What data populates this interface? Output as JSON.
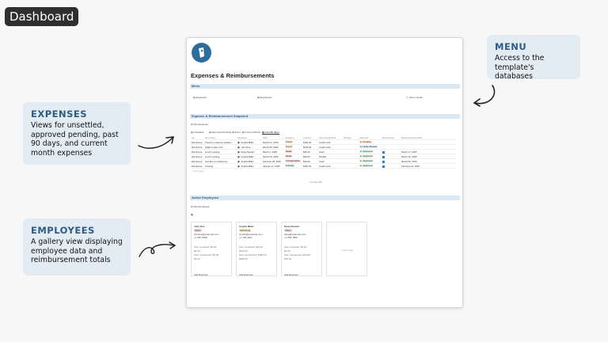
{
  "badge": "Dashboard",
  "callouts": {
    "expenses": {
      "title": "EXPENSES",
      "body": "Views for unsettled, approved pending, past 90 days, and current month expenses"
    },
    "employees": {
      "title": "EMPLOYEES",
      "body": "A gallery view displaying employee data and reimbursement totals"
    },
    "menu": {
      "title": "MENU",
      "body": "Access to the template's databases"
    }
  },
  "colors": {
    "accent": "#2d5b83",
    "callout_bg": "#e4ecf3",
    "section_bar": "#dbe8f3"
  },
  "page": {
    "title": "Expenses & Reimbursements",
    "menu": {
      "header": "Menu",
      "links": [
        {
          "label": "Expenses",
          "icon": "receipt-icon"
        },
        {
          "label": "Employees",
          "icon": "people-icon"
        },
        {
          "label": "How it works",
          "icon": "info-icon"
        }
      ]
    },
    "snapshot": {
      "header": "Expense & Reimbursement Snapshot",
      "new_button": "New Expense",
      "views": [
        "Unsettled",
        "Approved Pending Reimbu...",
        "Current Month",
        "Last 90 days"
      ],
      "columns": [
        "Aa",
        "Item Name",
        "Employee",
        "Date",
        "Category",
        "Amount",
        "Payment Method",
        "Receipt",
        "Approval",
        "Reimbursed",
        "Reimbursement Date"
      ],
      "rows": [
        {
          "type": "Reimburse",
          "item": "Travel to customer location",
          "employee": "Sophia Miller",
          "date": "March 01, 2025",
          "category": "Travel",
          "amount": "$100.00",
          "method": "Credit Card",
          "approval": "Pending",
          "reimbursed": false,
          "reimb_date": ""
        },
        {
          "type": "Reimburse",
          "item": "Flight to New York",
          "employee": "John Doe",
          "date": "March 08, 2025",
          "category": "Travel",
          "amount": "$135.00",
          "method": "Credit Card",
          "approval": "Under Review",
          "reimbursed": false,
          "reimb_date": ""
        },
        {
          "type": "Reimburse",
          "item": "Lunch meeting",
          "employee": "Dana Stewart",
          "date": "March 4, 2025",
          "category": "Meals",
          "amount": "$35.00",
          "method": "Cash",
          "approval": "Approved",
          "reimbursed": true,
          "reimb_date": "March 17, 2025"
        },
        {
          "type": "Reimburse",
          "item": "Lunch meeting",
          "employee": "Sophia Miller",
          "date": "March 03, 2025",
          "category": "Meals",
          "amount": "$45.00",
          "method": "PayPal",
          "approval": "Approved",
          "reimbursed": true,
          "reimb_date": "March 15, 2025"
        },
        {
          "type": "Reimburse",
          "item": "Taxi fare to conference",
          "employee": "Sophia Miller",
          "date": "February 28, 2025",
          "category": "Transportation",
          "amount": "$40.00",
          "method": "Cash",
          "approval": "Approved",
          "reimbursed": true,
          "reimb_date": "March 06, 2025"
        },
        {
          "type": "Reimburse",
          "item": "Training",
          "employee": "Sophia Miller",
          "date": "January 27, 2025",
          "category": "Training",
          "amount": "$300.00",
          "method": "Credit Card",
          "approval": "Approved",
          "reimbursed": true,
          "reimb_date": "February 10, 2025"
        }
      ],
      "new_row": "+ New page",
      "sum_label": "sum $1,185"
    },
    "employees": {
      "header": "Active Employees",
      "new_button": "New Employee",
      "cards": [
        {
          "name": "John Doe",
          "dept": "Sales",
          "dept_color": "#f7d7d7",
          "email": "johndoe@example.com",
          "phone": "+1 987 6548",
          "lines": [
            "Sum unsettled: $0.00",
            "$0.00",
            "Sum reimbursed: $0.00",
            "$0.00"
          ],
          "add": "Add Expense"
        },
        {
          "name": "Sophia Miller",
          "dept": "Marketing",
          "dept_color": "#fbe3c8",
          "email": "sophia@example.com",
          "phone": "+1 765 4321",
          "lines": [
            "Sum unsettled: $40.00",
            "$100.00",
            "Sum reimbursed: $385.00",
            "$385.00"
          ],
          "add": "Add Expense"
        },
        {
          "name": "Dana Stewart",
          "dept": "Sales",
          "dept_color": "#f7d7d7",
          "email": "dana@example.com",
          "phone": "+1 555 7890",
          "lines": [
            "Sum unsettled: $0.00",
            "$0.00",
            "Sum reimbursed: $35.00",
            "$35.00"
          ],
          "add": "Add Expense"
        }
      ],
      "new_card": "+ New page"
    }
  }
}
